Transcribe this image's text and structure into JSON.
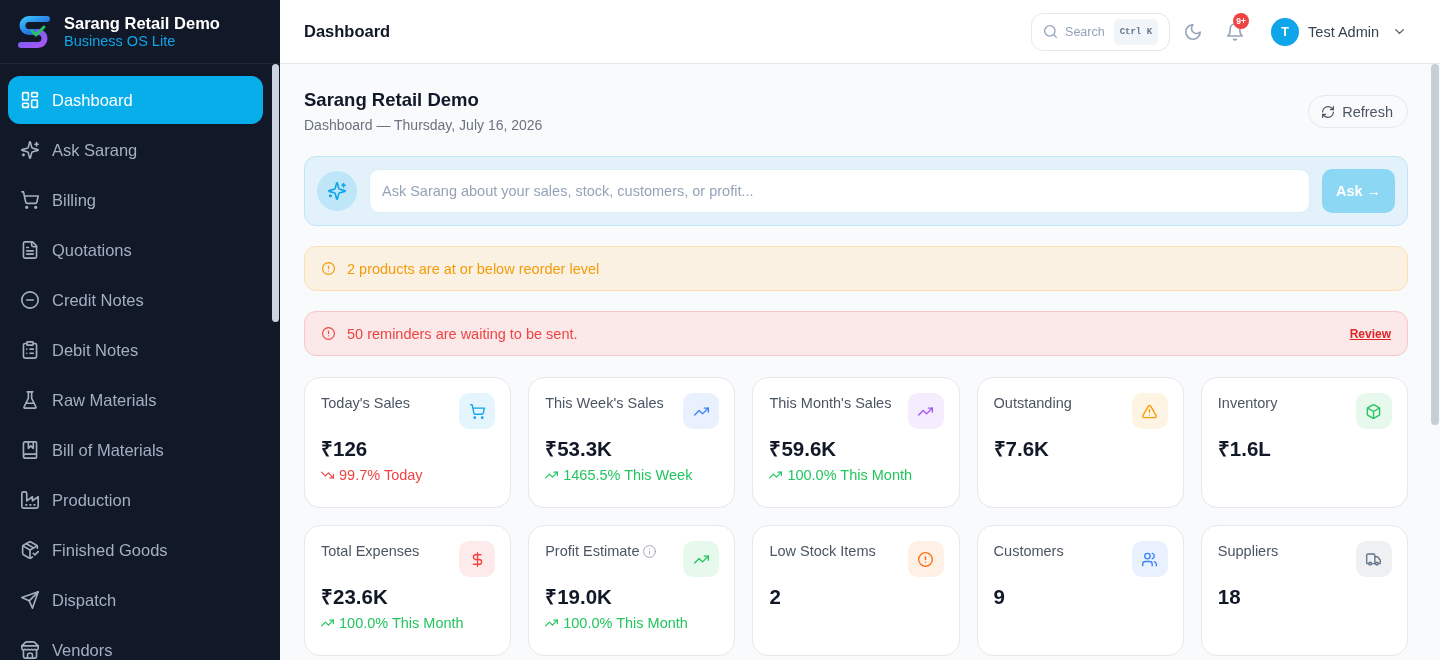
{
  "sidebar": {
    "brand": {
      "title": "Sarang Retail Demo",
      "subtitle": "Business OS Lite"
    },
    "items": [
      {
        "label": "Dashboard",
        "selected": true
      },
      {
        "label": "Ask Sarang",
        "selected": false
      },
      {
        "label": "Billing",
        "selected": false
      },
      {
        "label": "Quotations",
        "selected": false
      },
      {
        "label": "Credit Notes",
        "selected": false
      },
      {
        "label": "Debit Notes",
        "selected": false
      },
      {
        "label": "Raw Materials",
        "selected": false
      },
      {
        "label": "Bill of Materials",
        "selected": false
      },
      {
        "label": "Production",
        "selected": false
      },
      {
        "label": "Finished Goods",
        "selected": false
      },
      {
        "label": "Dispatch",
        "selected": false
      },
      {
        "label": "Vendors",
        "selected": false
      }
    ]
  },
  "topbar": {
    "title": "Dashboard",
    "search": {
      "placeholder": "Search",
      "shortcut": "Ctrl K"
    },
    "notifications": {
      "badge": "9+"
    },
    "user": {
      "initial": "T",
      "name": "Test Admin"
    }
  },
  "page": {
    "title": "Sarang Retail Demo",
    "subtitle": "Dashboard — Thursday, July 16, 2026",
    "refresh_button": "Refresh"
  },
  "ask_bar": {
    "placeholder": "Ask Sarang about your sales, stock, customers, or profit...",
    "button": {
      "label": "Ask →",
      "disabled": true
    }
  },
  "alerts": [
    {
      "kind": "warning",
      "text": "2 products are at or below reorder level"
    },
    {
      "kind": "danger",
      "text": "50 reminders are waiting to be sent.",
      "action": "Review"
    }
  ],
  "stats": [
    {
      "label": "Today's Sales",
      "value": "₹126",
      "change": {
        "kind": "down",
        "text": "99.7% Today"
      },
      "info": false,
      "color": "#0ea5e9"
    },
    {
      "label": "This Week's Sales",
      "value": "₹53.3K",
      "change": {
        "kind": "up",
        "text": "1465.5% This Week"
      },
      "info": false,
      "color": "#3b82f6"
    },
    {
      "label": "This Month's Sales",
      "value": "₹59.6K",
      "change": {
        "kind": "up",
        "text": "100.0% This Month"
      },
      "info": false,
      "color": "#a855f7"
    },
    {
      "label": "Outstanding",
      "value": "₹7.6K",
      "info": false,
      "color": "#f59e0b"
    },
    {
      "label": "Inventory",
      "value": "₹1.6L",
      "info": false,
      "color": "#22c55e"
    },
    {
      "label": "Total Expenses",
      "value": "₹23.6K",
      "change": {
        "kind": "up",
        "text": "100.0% This Month"
      },
      "info": false,
      "color": "#ef4444"
    },
    {
      "label": "Profit Estimate",
      "value": "₹19.0K",
      "change": {
        "kind": "up",
        "text": "100.0% This Month"
      },
      "info": true,
      "color": "#22c55e"
    },
    {
      "label": "Low Stock Items",
      "value": "2",
      "info": false,
      "color": "#f97316"
    },
    {
      "label": "Customers",
      "value": "9",
      "info": false,
      "color": "#3b82f6"
    },
    {
      "label": "Suppliers",
      "value": "18",
      "info": false,
      "color": "#64748b"
    }
  ]
}
